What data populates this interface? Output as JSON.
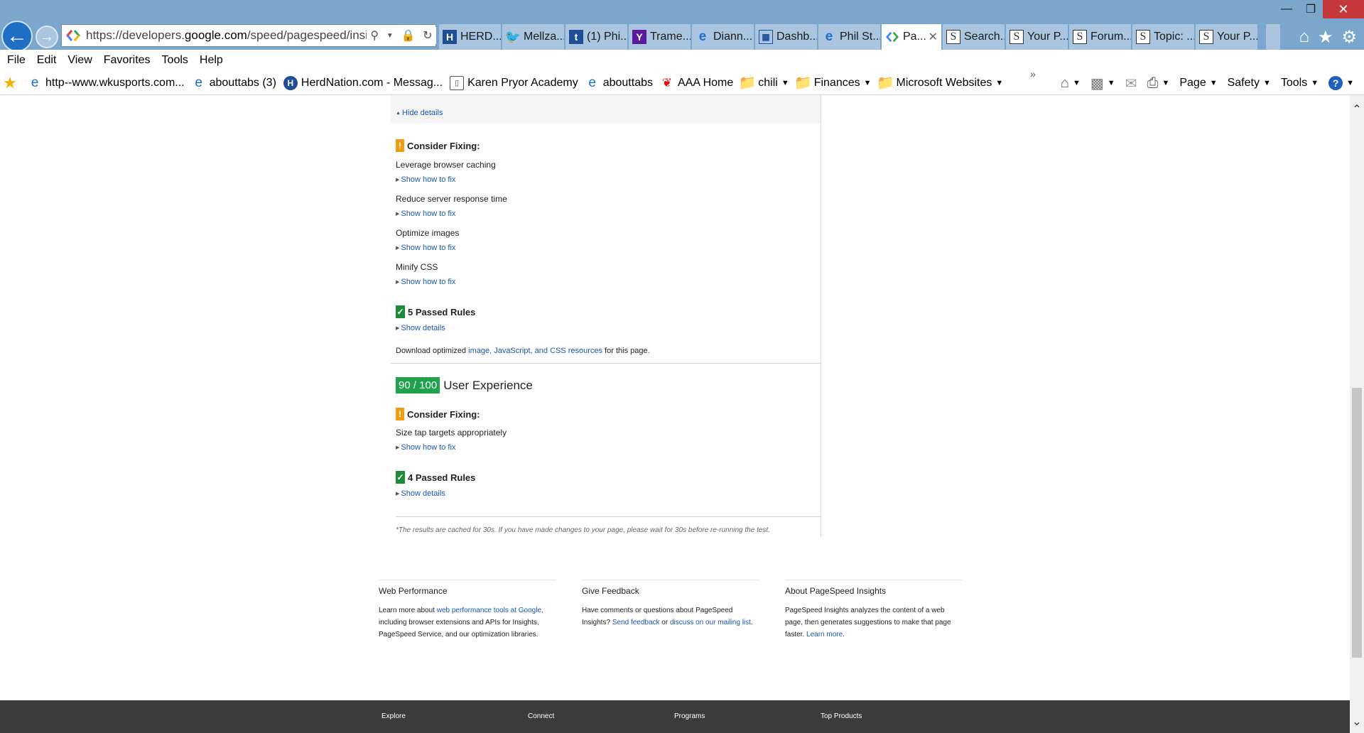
{
  "browser": {
    "address_prefix": "https://developers.",
    "address_domain": "google.com",
    "address_rest": "/speed/pagespeed/insights/",
    "tabs": [
      {
        "label": "HERD...",
        "icon": "herd"
      },
      {
        "label": "Mellza...",
        "icon": "tw"
      },
      {
        "label": "(1) Phi...",
        "icon": "twsq"
      },
      {
        "label": "Trame...",
        "icon": "yahoo"
      },
      {
        "label": "Diann...",
        "icon": "ie"
      },
      {
        "label": "Dashb...",
        "icon": "grid"
      },
      {
        "label": "Phil St...",
        "icon": "ie"
      },
      {
        "label": "Pa...",
        "icon": "google",
        "active": true
      },
      {
        "label": "Search...",
        "icon": "s"
      },
      {
        "label": "Your P...",
        "icon": "s"
      },
      {
        "label": "Forum...",
        "icon": "s"
      },
      {
        "label": "Topic: ...",
        "icon": "s"
      },
      {
        "label": "Your P...",
        "icon": "s"
      }
    ],
    "menu": [
      "File",
      "Edit",
      "View",
      "Favorites",
      "Tools",
      "Help"
    ],
    "favorites": [
      {
        "label": "http--www.wkusports.com...",
        "icon": "ie"
      },
      {
        "label": "abouttabs (3)",
        "icon": "ie"
      },
      {
        "label": "HerdNation.com - Messag...",
        "icon": "herd"
      },
      {
        "label": "Karen Pryor Academy",
        "icon": "page"
      },
      {
        "label": "abouttabs",
        "icon": "ie"
      },
      {
        "label": "AAA Home",
        "icon": "aaa"
      },
      {
        "label": "chili",
        "icon": "folder",
        "dropdown": true
      },
      {
        "label": "Finances",
        "icon": "folder",
        "dropdown": true
      },
      {
        "label": "Microsoft Websites",
        "icon": "folder",
        "dropdown": true
      }
    ],
    "commands": {
      "page": "Page",
      "safety": "Safety",
      "tools": "Tools"
    }
  },
  "results": {
    "hide_details": "Hide details",
    "speed_consider_label": "Consider Fixing:",
    "speed_rules": [
      {
        "name": "Leverage browser caching",
        "fix": "Show how to fix"
      },
      {
        "name": "Reduce server response time",
        "fix": "Show how to fix"
      },
      {
        "name": "Optimize images",
        "fix": "Show how to fix"
      },
      {
        "name": "Minify CSS",
        "fix": "Show how to fix"
      }
    ],
    "speed_passed": "5 Passed Rules",
    "speed_show_details": "Show details",
    "download": {
      "prefix": "Download optimized ",
      "link": "image, JavaScript, and CSS resources",
      "suffix": " for this page."
    },
    "ux_score": "90 / 100",
    "ux_label": "User Experience",
    "ux_consider_label": "Consider Fixing:",
    "ux_rule": "Size tap targets appropriately",
    "ux_fix": "Show how to fix",
    "ux_passed": "4 Passed Rules",
    "ux_show_details": "Show details",
    "cache_note": "*The results are cached for 30s. If you have made changes to your page, please wait for 30s before re-running the test."
  },
  "footer_cols": {
    "perf": {
      "title": "Web Performance",
      "t1": "Learn more about ",
      "l1": "web performance tools at Google,",
      "t2": " including browser extensions and APIs for Insights, PageSpeed Service, and our optimization libraries."
    },
    "feedback": {
      "title": "Give Feedback",
      "t1": "Have comments or questions about PageSpeed Insights? ",
      "l1": "Send feedback",
      "t2": " or ",
      "l2": "discuss on our mailing list",
      "t3": "."
    },
    "about": {
      "title": "About PageSpeed Insights",
      "t1": "PageSpeed Insights analyzes the content of a web page, then generates suggestions to make that page faster. ",
      "l1": "Learn more",
      "t2": "."
    }
  },
  "dark_footer": [
    "Explore",
    "Connect",
    "Programs",
    "Top Products"
  ],
  "colors": {
    "warn": "#f39c12",
    "pass": "#1e8b3a",
    "score": "#1ea34c",
    "link": "#1a56b5"
  }
}
